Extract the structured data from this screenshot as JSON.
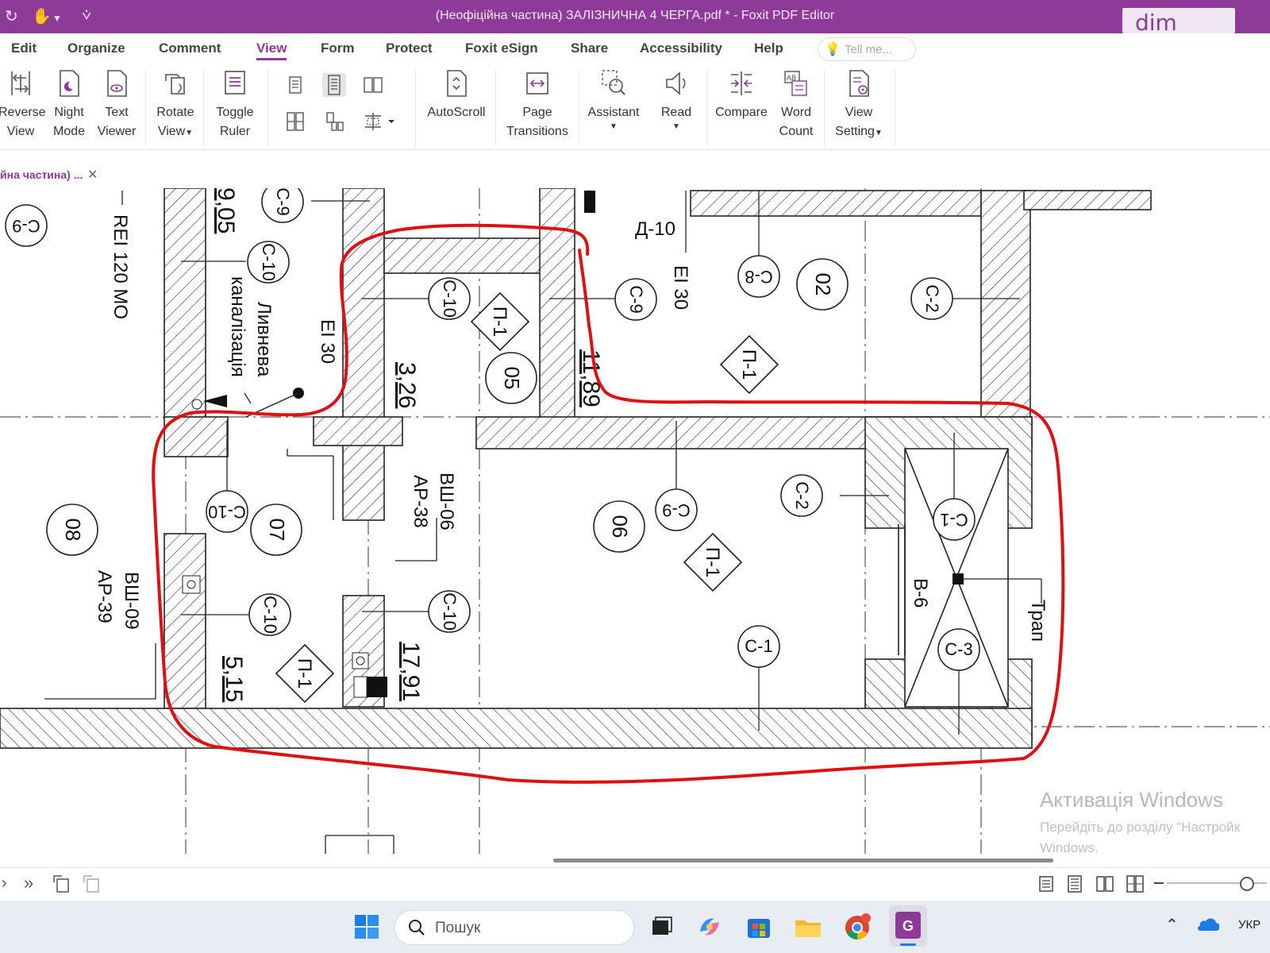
{
  "window": {
    "title": "(Неофіційна частина) ЗАЛІЗНИЧНА 4 ЧЕРГА.pdf * - Foxit PDF Editor",
    "badge": "dim"
  },
  "menu": {
    "tabs": [
      "Edit",
      "Organize",
      "Comment",
      "View",
      "Form",
      "Protect",
      "Foxit eSign",
      "Share",
      "Accessibility",
      "Help"
    ],
    "active": "View",
    "tell_me_placeholder": "Tell me..."
  },
  "ribbon": {
    "reverse_view": [
      "Reverse",
      "View"
    ],
    "night_mode": [
      "Night",
      "Mode"
    ],
    "text_viewer": [
      "Text",
      "Viewer"
    ],
    "rotate_view": [
      "Rotate",
      "View"
    ],
    "toggle_ruler": [
      "Toggle",
      "Ruler"
    ],
    "autoscroll": "AutoScroll",
    "page_transitions": [
      "Page",
      "Transitions"
    ],
    "assistant": "Assistant",
    "read": "Read",
    "compare": "Compare",
    "word_count": [
      "Word",
      "Count"
    ],
    "view_setting": [
      "View",
      "Setting"
    ]
  },
  "doc_tab": {
    "label": "йна частина) ..."
  },
  "drawing": {
    "room_numbers": [
      "08",
      "07",
      "05",
      "06",
      "02"
    ],
    "wall_tags": [
      "С-9",
      "С-10",
      "С-10",
      "С-9",
      "С-9",
      "С-10",
      "С-9",
      "С-8",
      "С-2",
      "С-2",
      "С-1",
      "С-10",
      "С-1",
      "С-3"
    ],
    "floor_tags": [
      "П-1",
      "П-1",
      "П-1",
      "П-1"
    ],
    "labels": {
      "rei": "REI 120 МО",
      "ei30_left": "ЕІ 30",
      "ei30_right": "ЕІ 30",
      "drain1": "Ливнева",
      "drain2": "каналізація",
      "door": "Д-10",
      "vsh06": "ВШ-06",
      "ar38": "АР-38",
      "vsh09": "ВШ-09",
      "ar39": "АР-39",
      "b6": "В-6",
      "trap": "Трап"
    },
    "areas": [
      "9,05",
      "3,26",
      "11,89",
      "5,15",
      "17,91"
    ]
  },
  "watermark": {
    "line1": "Активація Windows",
    "line2": "Перейдіть до розділу \"Настройк",
    "line3": "Windows."
  },
  "taskbar": {
    "search_placeholder": "Пошук",
    "language": "УКР"
  },
  "colors": {
    "accent": "#8e3a98",
    "markup": "#e01010"
  }
}
